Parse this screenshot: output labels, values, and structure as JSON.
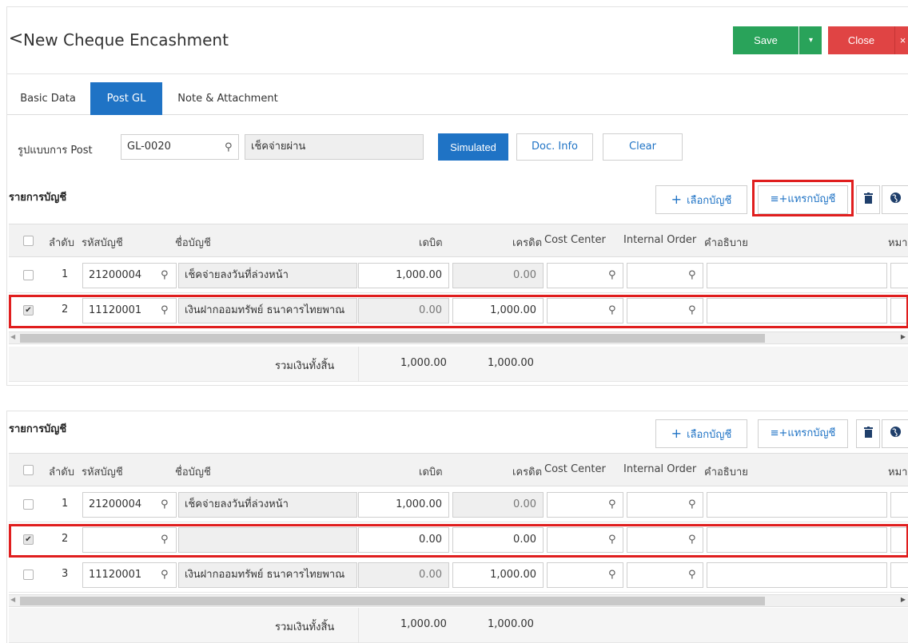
{
  "header": {
    "back_icon": "<",
    "title": "New Cheque Encashment",
    "save_label": "Save",
    "save_caret": "▾",
    "close_label": "Close",
    "close_x": "×",
    "save_color": "#29a35a",
    "close_color": "#e04444"
  },
  "tabs": [
    {
      "label": "Basic Data",
      "active": false
    },
    {
      "label": "Post GL",
      "active": true
    },
    {
      "label": "Note & Attachment",
      "active": false
    }
  ],
  "post_form": {
    "label": "รูปแบบการ Post",
    "code_value": "GL-0020",
    "name_value": "เช็คจ่ายผ่าน",
    "simulated_label": "Simulated",
    "docinfo_label": "Doc. Info",
    "clear_label": "Clear"
  },
  "toolbar": {
    "section_title": "รายการบัญชี",
    "select_account": "เลือกบัญชี",
    "insert_account": "แทรกบัญชี",
    "insert_icon": "≡+",
    "delete_icon": "trash-icon",
    "globe_icon": "globe-icon"
  },
  "columns": {
    "seq": "ลำดับ",
    "code": "รหัสบัญชี",
    "name": "ชื่อบัญชี",
    "debit": "เดบิต",
    "credit": "เครดิต",
    "cost_center": "Cost Center",
    "internal_order": "Internal Order",
    "description": "คำอธิบาย",
    "note": "หมา"
  },
  "table_top": {
    "rows": [
      {
        "seq": "1",
        "code": "21200004",
        "name": "เช็คจ่ายลงวันที่ล่วงหน้า",
        "debit": "1,000.00",
        "credit": "0.00",
        "checked": false
      },
      {
        "seq": "2",
        "code": "11120001",
        "name": "เงินฝากออมทรัพย์ ธนาคารไทยพาณ",
        "debit": "0.00",
        "credit": "1,000.00",
        "checked": true
      }
    ],
    "total_label": "รวมเงินทั้งสิ้น",
    "total_debit": "1,000.00",
    "total_credit": "1,000.00"
  },
  "table_bottom": {
    "rows": [
      {
        "seq": "1",
        "code": "21200004",
        "name": "เช็คจ่ายลงวันที่ล่วงหน้า",
        "debit": "1,000.00",
        "credit": "0.00",
        "checked": false
      },
      {
        "seq": "2",
        "code": "",
        "name": "",
        "debit": "0.00",
        "credit": "0.00",
        "checked": true
      },
      {
        "seq": "3",
        "code": "11120001",
        "name": "เงินฝากออมทรัพย์ ธนาคารไทยพาณ",
        "debit": "0.00",
        "credit": "1,000.00",
        "checked": false
      }
    ],
    "total_label": "รวมเงินทั้งสิ้น",
    "total_debit": "1,000.00",
    "total_credit": "1,000.00"
  },
  "checkmark": "✔",
  "search_glyph": "⚲"
}
